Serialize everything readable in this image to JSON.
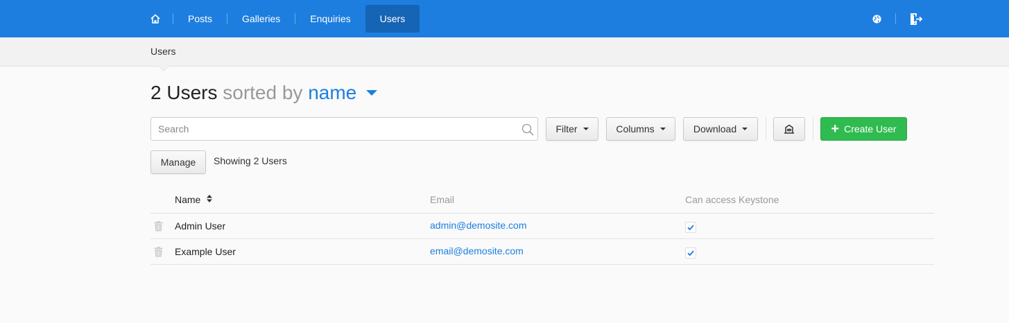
{
  "nav": {
    "items": [
      {
        "label": "Posts"
      },
      {
        "label": "Galleries"
      },
      {
        "label": "Enquiries"
      },
      {
        "label": "Users",
        "active": true
      }
    ],
    "home_icon": "home-icon",
    "right_icons": [
      "globe-icon",
      "sign-out-icon"
    ]
  },
  "breadcrumb": {
    "current": "Users"
  },
  "title": {
    "count_text": "2 Users",
    "sorted_by_text": "sorted by",
    "sort_field": "name"
  },
  "toolbar": {
    "search_placeholder": "Search",
    "search_value": "",
    "filter_label": "Filter",
    "columns_label": "Columns",
    "download_label": "Download",
    "expand_icon": "expand-table-icon",
    "create_label": "Create User",
    "manage_label": "Manage",
    "showing_text": "Showing 2 Users"
  },
  "table": {
    "columns": [
      "Name",
      "Email",
      "Can access Keystone"
    ],
    "rows": [
      {
        "name": "Admin User",
        "email": "admin@demosite.com",
        "can_access_keystone": true
      },
      {
        "name": "Example User",
        "email": "email@demosite.com",
        "can_access_keystone": true
      }
    ]
  },
  "colors": {
    "primary": "#1d7edf",
    "primary_active": "#1564b5",
    "success": "#2fbb4f",
    "muted": "#999999"
  }
}
